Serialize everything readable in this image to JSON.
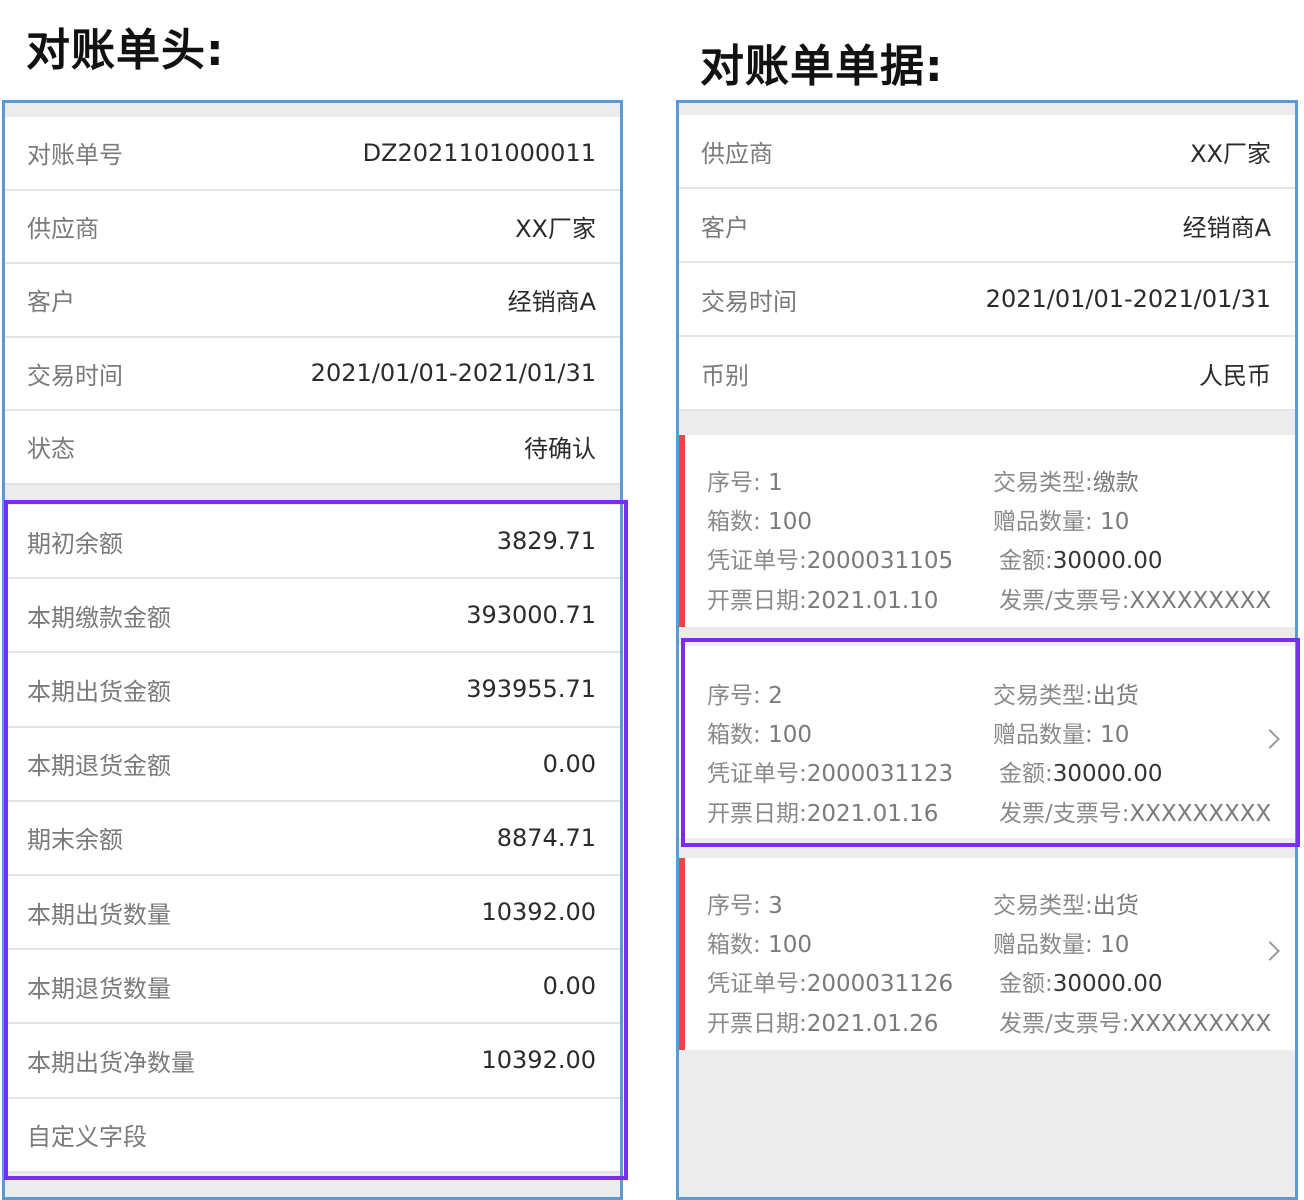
{
  "headings": {
    "left": "对账单头:",
    "right": "对账单单据:"
  },
  "colors": {
    "panel_border": "#5b9bd5",
    "highlight": "#7b2cf0",
    "card_accent": "#ef4444"
  },
  "left_header": [
    {
      "label": "对账单号",
      "value": "DZ2021101000011"
    },
    {
      "label": "供应商",
      "value": "XX厂家"
    },
    {
      "label": "客户",
      "value": "经销商A"
    },
    {
      "label": "交易时间",
      "value": "2021/01/01-2021/01/31"
    },
    {
      "label": "状态",
      "value": "待确认"
    }
  ],
  "left_summary": [
    {
      "label": "期初余额",
      "value": "3829.71"
    },
    {
      "label": "本期缴款金额",
      "value": "393000.71"
    },
    {
      "label": "本期出货金额",
      "value": "393955.71"
    },
    {
      "label": "本期退货金额",
      "value": "0.00"
    },
    {
      "label": "期末余额",
      "value": "8874.71"
    },
    {
      "label": "本期出货数量",
      "value": "10392.00"
    },
    {
      "label": "本期退货数量",
      "value": "0.00"
    },
    {
      "label": "本期出货净数量",
      "value": "10392.00"
    },
    {
      "label": "自定义字段",
      "value": ""
    }
  ],
  "right_header": [
    {
      "label": "供应商",
      "value": "XX厂家"
    },
    {
      "label": "客户",
      "value": "经销商A"
    },
    {
      "label": "交易时间",
      "value": "2021/01/01-2021/01/31"
    },
    {
      "label": "币别",
      "value": "人民币"
    }
  ],
  "field_labels": {
    "seq": "序号:",
    "trade_type": "交易类型:",
    "boxes": "箱数:",
    "gift_qty": "赠品数量:",
    "voucher_no": "凭证单号:",
    "amount": "金额:",
    "invoice_date": "开票日期:",
    "invoice_no": "发票/支票号:"
  },
  "cards": [
    {
      "seq": "1",
      "trade_type": "缴款",
      "boxes": "100",
      "gift_qty": "10",
      "voucher_no": "2000031105",
      "amount": "30000.00",
      "invoice_date": "2021.01.10",
      "invoice_no": "XXXXXXXXX"
    },
    {
      "seq": "2",
      "trade_type": "出货",
      "boxes": "100",
      "gift_qty": "10",
      "voucher_no": "2000031123",
      "amount": "30000.00",
      "invoice_date": "2021.01.16",
      "invoice_no": "XXXXXXXXX"
    },
    {
      "seq": "3",
      "trade_type": "出货",
      "boxes": "100",
      "gift_qty": "10",
      "voucher_no": "2000031126",
      "amount": "30000.00",
      "invoice_date": "2021.01.26",
      "invoice_no": "XXXXXXXXX"
    }
  ]
}
